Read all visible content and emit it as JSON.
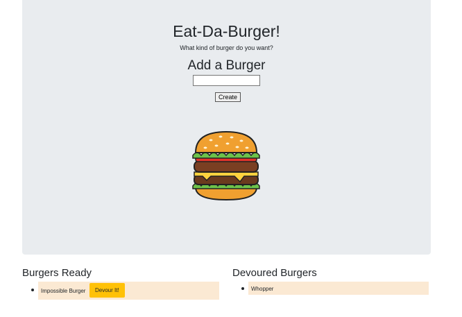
{
  "header": {
    "title": "Eat-Da-Burger!",
    "subtitle": "What kind of burger do you want?"
  },
  "form": {
    "heading": "Add a Burger",
    "input_value": "",
    "create_label": "Create"
  },
  "ready": {
    "heading": "Burgers Ready",
    "items": [
      {
        "name": "Impossible Burger",
        "action_label": "Devour It!"
      }
    ]
  },
  "devoured": {
    "heading": "Devoured Burgers",
    "items": [
      {
        "name": "Whopper"
      }
    ]
  },
  "colors": {
    "jumbotron": "#e9ecef",
    "item_bg": "#fbe9d3",
    "devour_button": "#ffc107"
  }
}
